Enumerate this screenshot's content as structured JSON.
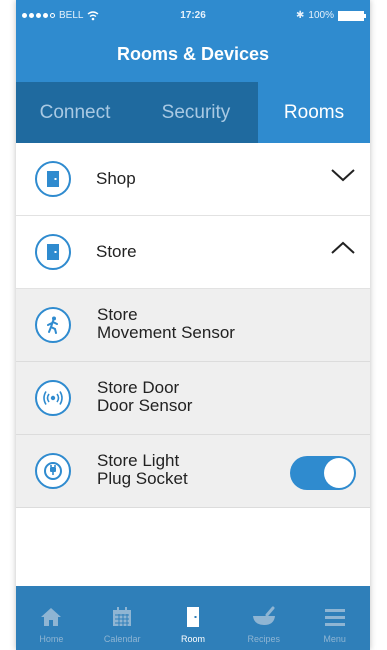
{
  "status_bar": {
    "carrier": "BELL",
    "time": "17:26",
    "battery": "100%"
  },
  "header": {
    "title": "Rooms & Devices"
  },
  "tabs": [
    {
      "label": "Connect",
      "active": false
    },
    {
      "label": "Security",
      "active": false
    },
    {
      "label": "Rooms",
      "active": true
    }
  ],
  "rooms": [
    {
      "label": "Shop",
      "expanded": false,
      "icon": "door-icon"
    },
    {
      "label": "Store",
      "expanded": true,
      "icon": "door-icon"
    }
  ],
  "devices": [
    {
      "line1": "Store",
      "line2": "Movement Sensor",
      "icon": "walking-person-icon"
    },
    {
      "line1": "Store Door",
      "line2": "Door Sensor",
      "icon": "signal-waves-icon"
    },
    {
      "line1": "Store Light",
      "line2": "Plug Socket",
      "icon": "plug-icon",
      "toggle_on": true
    }
  ],
  "bottom_nav": [
    {
      "label": "Home",
      "icon": "home-icon",
      "active": false
    },
    {
      "label": "Calendar",
      "icon": "calendar-icon",
      "active": false
    },
    {
      "label": "Room",
      "icon": "door-icon",
      "active": true
    },
    {
      "label": "Recipes",
      "icon": "bowl-icon",
      "active": false
    },
    {
      "label": "Menu",
      "icon": "menu-icon",
      "active": false
    }
  ],
  "colors": {
    "primary": "#2f8bcf",
    "tab_bar": "#1f6a9f",
    "bottom_bar": "#2f7fb9"
  }
}
